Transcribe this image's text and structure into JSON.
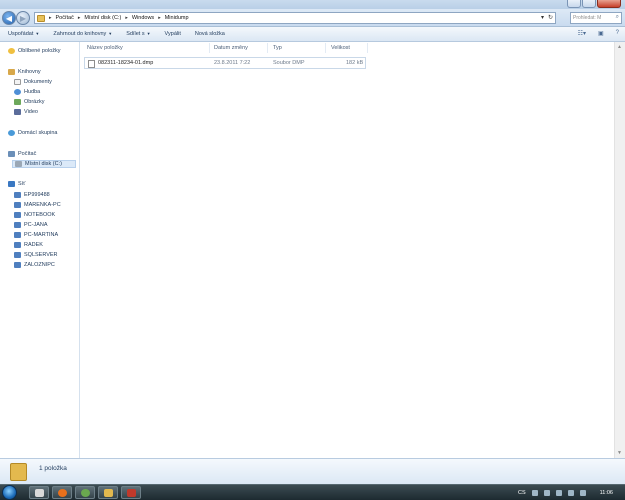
{
  "address": {
    "segments": [
      "Počítač",
      "Místní disk (C:)",
      "Windows",
      "Minidump"
    ]
  },
  "search": {
    "placeholder": "Prohledat: M"
  },
  "toolbar": {
    "organize": "Uspořádat",
    "include": "Zahrnout do knihovny",
    "share": "Sdílet s",
    "burn": "Vypálit",
    "new_folder": "Nová složka"
  },
  "navigation": {
    "favorites": "Oblíbené položky",
    "libraries": "Knihovny",
    "library_items": [
      "Dokumenty",
      "Hudba",
      "Obrázky",
      "Video"
    ],
    "homegroup": "Domácí skupina",
    "computer": "Počítač",
    "computer_items": [
      "Místní disk (C:)"
    ],
    "network": "Síť",
    "network_items": [
      "EP999488",
      "MARENKA-PC",
      "NOTEBOOK",
      "PC-JANA",
      "PC-MARTINA",
      "RADEK",
      "SQLSERVER",
      "ZALOZNIPC"
    ]
  },
  "columns": {
    "name": "Název položky",
    "date": "Datum změny",
    "type": "Typ",
    "size": "Velikost"
  },
  "files": [
    {
      "name": "082311-18234-01.dmp",
      "date": "23.8.2011 7:22",
      "type": "Soubor DMP",
      "size": "182 kB"
    }
  ],
  "details": {
    "status": "1 položka"
  },
  "taskbar": {
    "language": "CS",
    "time": "11:06"
  },
  "colors": {
    "accent": "#1e395b",
    "toolbar_bg": "#dbe7f4",
    "selection": "#dbe9f8",
    "taskbar": "#2a383e"
  }
}
